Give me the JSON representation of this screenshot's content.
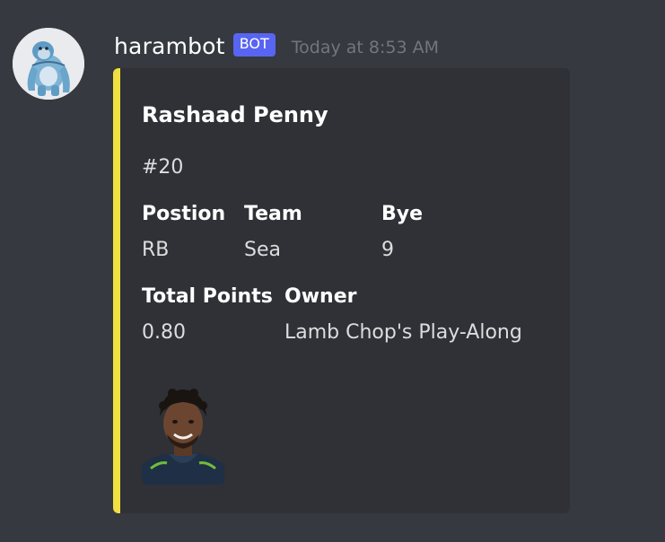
{
  "message": {
    "username": "harambot",
    "bot_tag": "BOT",
    "timestamp": "Today at 8:53 AM",
    "avatar_icon": "gorilla-avatar-icon"
  },
  "embed": {
    "accent_color": "#f0e040",
    "title": "Rashaad Penny",
    "description": "#20",
    "fields": [
      {
        "name": "Postion",
        "value": "RB"
      },
      {
        "name": "Team",
        "value": "Sea"
      },
      {
        "name": "Bye",
        "value": "9"
      },
      {
        "name": "Total Points",
        "value": "0.80"
      },
      {
        "name": "Owner",
        "value": "Lamb Chop's Play-Along"
      }
    ],
    "thumbnail_icon": "player-headshot-image"
  }
}
